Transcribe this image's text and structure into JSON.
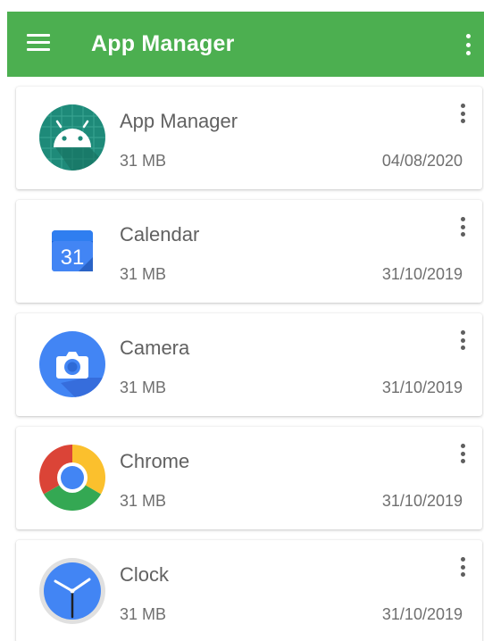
{
  "app_bar": {
    "title": "App Manager",
    "menu_icon": "hamburger-menu-icon",
    "overflow_icon": "more-vert-icon",
    "color": "#4caf50"
  },
  "apps": [
    {
      "name": "App Manager",
      "size": "31 MB",
      "date": "04/08/2020",
      "icon": "android-icon"
    },
    {
      "name": "Calendar",
      "size": "31 MB",
      "date": "31/10/2019",
      "icon": "calendar-icon"
    },
    {
      "name": "Camera",
      "size": "31 MB",
      "date": "31/10/2019",
      "icon": "camera-icon"
    },
    {
      "name": "Chrome",
      "size": "31 MB",
      "date": "31/10/2019",
      "icon": "chrome-icon"
    },
    {
      "name": "Clock",
      "size": "31 MB",
      "date": "31/10/2019",
      "icon": "clock-icon"
    }
  ],
  "calendar_icon_day": "31"
}
